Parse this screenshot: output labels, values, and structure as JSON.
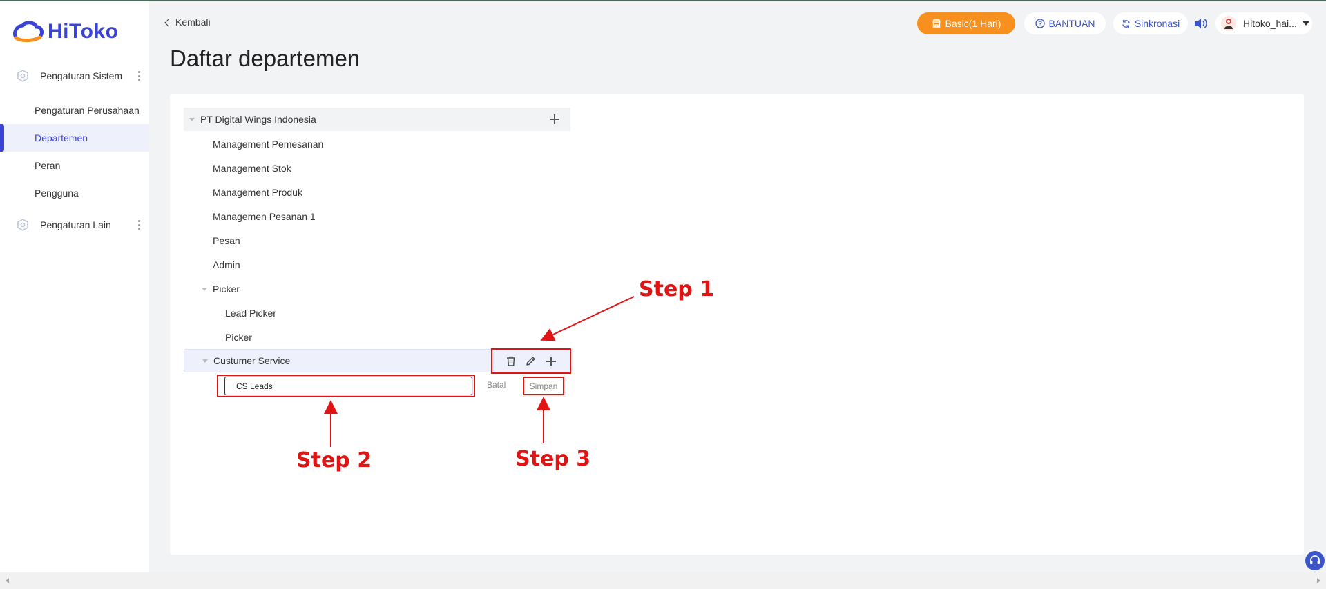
{
  "app": {
    "logo_text": "HiToko"
  },
  "sidebar": {
    "groups": [
      {
        "label": "Pengaturan Sistem",
        "icon": "hexagon-gear-icon"
      },
      {
        "label": "Pengaturan Lain",
        "icon": "hexagon-gear-icon"
      }
    ],
    "items": [
      {
        "label": "Pengaturan Perusahaan"
      },
      {
        "label": "Departemen",
        "active": true
      },
      {
        "label": "Peran"
      },
      {
        "label": "Pengguna"
      }
    ]
  },
  "header": {
    "back_label": "Kembali",
    "title": "Daftar departemen",
    "plan_label": "Basic(1 Hari)",
    "help_label": "BANTUAN",
    "sync_label": "Sinkronasi",
    "user_label": "Hitoko_hai..."
  },
  "tree": {
    "root": "PT Digital Wings Indonesia",
    "nodes": [
      "Management Pemesanan",
      "Management Stok",
      "Management Produk",
      "Managemen Pesanan 1",
      "Pesan",
      "Admin"
    ],
    "picker": {
      "label": "Picker",
      "children": [
        "Lead Picker",
        "Picker"
      ]
    },
    "customer_service": "Custumer Service"
  },
  "editor": {
    "input_value": "CS Leads",
    "cancel_label": "Batal",
    "save_label": "Simpan"
  },
  "annotations": {
    "step1": "Step 1",
    "step2": "Step 2",
    "step3": "Step 3"
  },
  "colors": {
    "primary": "#3b44d6",
    "accent_orange": "#f7901e",
    "annotation_red": "#e01414"
  }
}
